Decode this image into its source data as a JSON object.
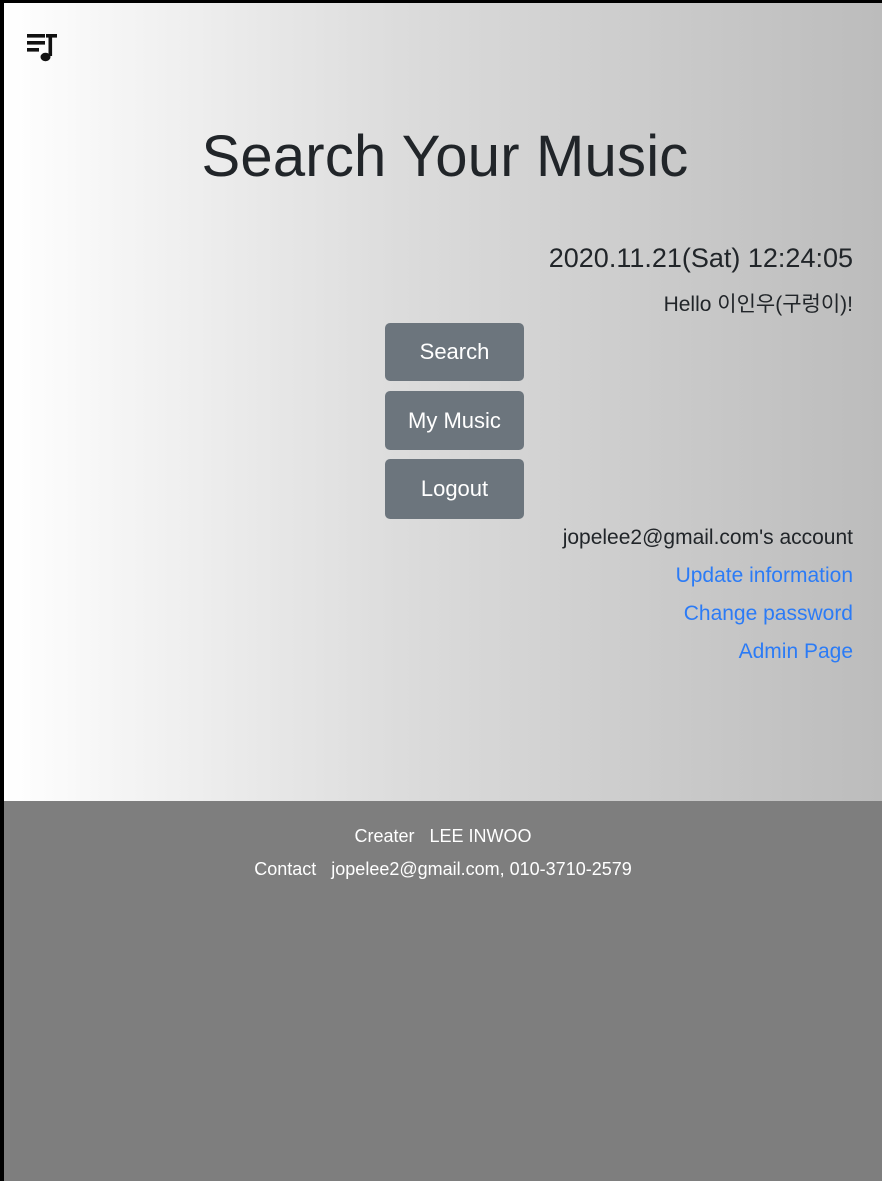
{
  "header": {
    "menu_icon": "music-queue-icon",
    "title": "Search Your Music"
  },
  "status": {
    "datetime": "2020.11.21(Sat) 12:24:05",
    "greeting": "Hello 이인우(구렁이)!"
  },
  "menu": {
    "search_label": "Search",
    "my_music_label": "My Music",
    "logout_label": "Logout"
  },
  "account": {
    "label": "jopelee2@gmail.com's account",
    "update_link": "Update information",
    "password_link": "Change password",
    "admin_link": "Admin Page"
  },
  "footer": {
    "creator_line": "Creater   LEE INWOO",
    "contact_line": "Contact   jopelee2@gmail.com, 010-3710-2579"
  },
  "colors": {
    "button_bg": "#6c757d",
    "link": "#2b7bf6",
    "footer_bg": "#7e7e7e"
  }
}
